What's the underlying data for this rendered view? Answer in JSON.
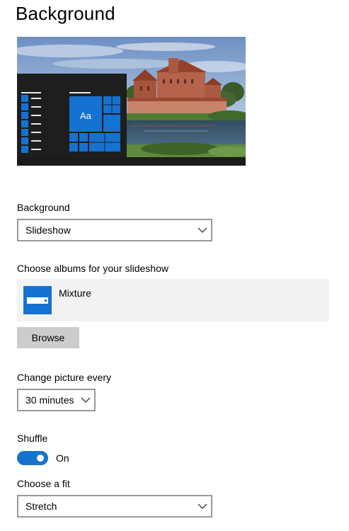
{
  "page": {
    "title": "Background"
  },
  "preview": {
    "tile_label": "Aa",
    "accent_color": "#1572d1"
  },
  "background": {
    "label": "Background",
    "selected": "Slideshow"
  },
  "albums": {
    "label": "Choose albums for your slideshow",
    "items": [
      {
        "name": "Mixture",
        "icon": "folder-album-icon"
      }
    ],
    "browse_label": "Browse"
  },
  "interval": {
    "label": "Change picture every",
    "selected": "30 minutes"
  },
  "shuffle": {
    "label": "Shuffle",
    "state": "On",
    "on": true
  },
  "fit": {
    "label": "Choose a fit",
    "selected": "Stretch"
  },
  "icons": {
    "dropdown": "chevron-down-icon"
  }
}
